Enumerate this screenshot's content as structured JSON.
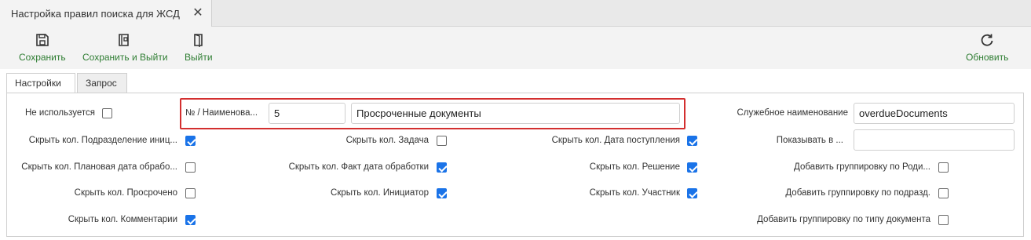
{
  "tab": {
    "title": "Настройка правил поиска для ЖСД",
    "close_icon": "close-icon"
  },
  "toolbar": {
    "save": "Сохранить",
    "save_exit": "Сохранить и Выйти",
    "exit": "Выйти",
    "refresh": "Обновить",
    "accent": "#2e7d32"
  },
  "subtabs": {
    "settings": "Настройки",
    "query": "Запрос"
  },
  "form": {
    "not_used": {
      "label": "Не используется",
      "checked": false
    },
    "num_name_label": "№ / Наименова...",
    "number_value": "5",
    "name_value": "Просроченные документы",
    "service_name_label": "Служебное наименование",
    "service_name_value": "overdueDocuments",
    "show_in_label": "Показывать в ...",
    "show_in_value": "",
    "col1": [
      {
        "label": "Скрыть кол. Подразделение иниц...",
        "checked": true
      },
      {
        "label": "Скрыть кол. Плановая дата обрабо...",
        "checked": false
      },
      {
        "label": "Скрыть кол. Просрочено",
        "checked": false
      },
      {
        "label": "Скрыть кол. Комментарии",
        "checked": true
      }
    ],
    "col2": [
      {
        "label": "Скрыть кол. Задача",
        "checked": false
      },
      {
        "label": "Скрыть кол. Факт дата обработки",
        "checked": true
      },
      {
        "label": "Скрыть кол. Инициатор",
        "checked": true
      }
    ],
    "col3": [
      {
        "label": "Скрыть кол. Дата поступления",
        "checked": true
      },
      {
        "label": "Скрыть кол. Решение",
        "checked": true
      },
      {
        "label": "Скрыть кол. Участник",
        "checked": true
      }
    ],
    "col4": [
      {
        "label": "Добавить группировку по Роди...",
        "checked": false
      },
      {
        "label": "Добавить группировку по подразд.",
        "checked": false
      },
      {
        "label": "Добавить группировку по типу документа",
        "checked": false
      }
    ],
    "highlight_color": "#d32f2f",
    "checkbox_color": "#1a73e8"
  }
}
